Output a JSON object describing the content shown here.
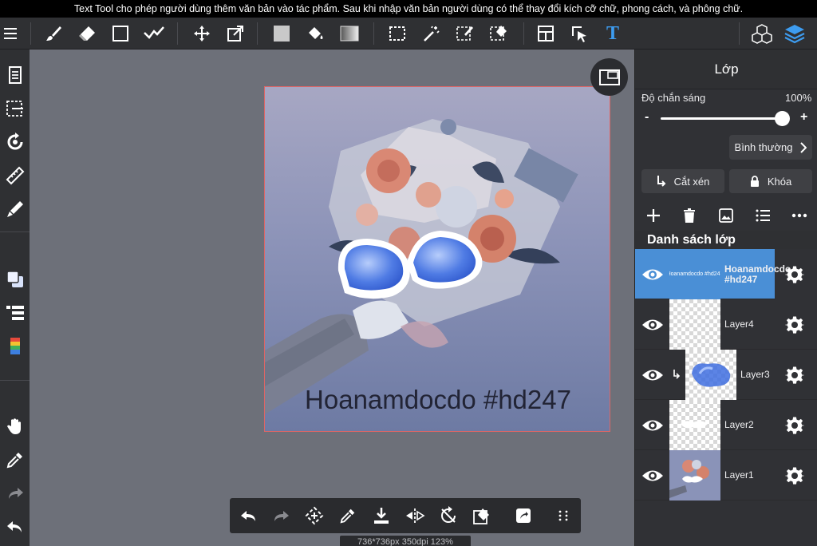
{
  "info_bar": {
    "message": "Text Tool cho phép người dùng thêm văn bản vào tác phẩm. Sau khi nhập văn bản người dùng có thể thay đổi kích cỡ chữ, phong cách, và phông chữ."
  },
  "toolbar": {
    "text_tool_glyph": "T",
    "icons": [
      "menu-icon",
      "brush-icon",
      "eraser-icon",
      "shape-rect-icon",
      "correction-icon",
      "move-icon",
      "transform-icon",
      "fill-color-icon",
      "bucket-icon",
      "gradient-icon",
      "select-rect-icon",
      "magic-wand-icon",
      "select-pen-icon",
      "select-eraser-icon",
      "frame-divider-icon",
      "operation-icon",
      "text-tool-icon",
      "material-icon",
      "layers-icon"
    ]
  },
  "left_rail": {
    "icons": [
      "file-icon",
      "selection-icon",
      "rotate-canvas-icon",
      "ruler-icon",
      "snap-icon",
      "color-icon",
      "layer-list-icon",
      "palette-icon",
      "hand-icon",
      "eyedropper-icon",
      "redo-icon",
      "undo-icon"
    ]
  },
  "canvas": {
    "text": "Hoanamdocdo #hd247",
    "text_color": "#222435"
  },
  "bottom_bar": {
    "icons": [
      "undo-icon",
      "redo-icon",
      "transform-icon",
      "eyedropper-icon",
      "save-icon",
      "flip-icon",
      "rotate-icon",
      "eraser-icon",
      "share-icon",
      "more-grid-icon"
    ]
  },
  "status": {
    "text": "736*736px 350dpi 123%"
  },
  "layer_panel": {
    "title": "Lớp",
    "opacity_label": "Độ chắn sáng",
    "opacity_value": "100%",
    "opacity_fraction": 1.0,
    "minus": "-",
    "plus": "+",
    "blend_mode": "Bình thường",
    "clip_label": "Cắt xén",
    "lock_label": "Khóa",
    "list_header": "Danh sách lớp",
    "accent_color": "#4a8fd6",
    "layers": [
      {
        "name": "Hoanamdocdo #hd247",
        "selected": true
      },
      {
        "name": "Layer4",
        "selected": false
      },
      {
        "name": "Layer3",
        "selected": false,
        "clipped": true
      },
      {
        "name": "Layer2",
        "selected": false
      },
      {
        "name": "Layer1",
        "selected": false
      }
    ]
  }
}
